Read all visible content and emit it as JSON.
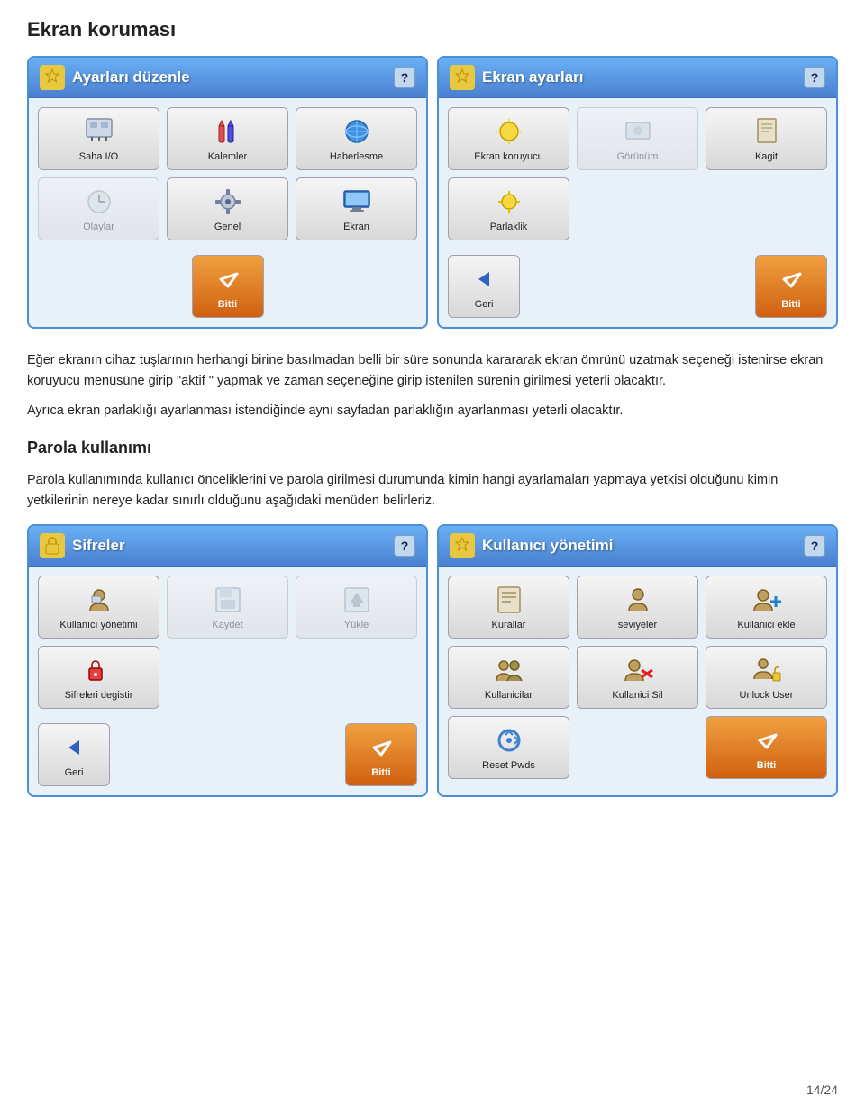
{
  "page": {
    "title": "Ekran koruması",
    "page_num": "14/24"
  },
  "panel1": {
    "header": "Ayarları düzenle",
    "help": "?",
    "buttons": [
      {
        "label": "Saha I/O",
        "icon": "wrench",
        "disabled": false
      },
      {
        "label": "Kalemler",
        "icon": "pen",
        "disabled": false
      },
      {
        "label": "Haberlesme",
        "icon": "comm",
        "disabled": false
      },
      {
        "label": "Olaylar",
        "icon": "clock",
        "disabled": true
      },
      {
        "label": "Genel",
        "icon": "gear",
        "disabled": false
      },
      {
        "label": "Ekran",
        "icon": "screen",
        "disabled": false
      }
    ],
    "bitti": "Bitti"
  },
  "panel2": {
    "header": "Ekran ayarları",
    "help": "?",
    "buttons": [
      {
        "label": "Ekran koruyucu",
        "icon": "sun",
        "disabled": false
      },
      {
        "label": "Görünüm",
        "icon": "theme",
        "disabled": true
      },
      {
        "label": "Kagit",
        "icon": "page",
        "disabled": false
      },
      {
        "label": "Parlaklik",
        "icon": "brightness",
        "disabled": false
      }
    ],
    "geri": "Geri",
    "bitti": "Bitti"
  },
  "texts": [
    "Eğer ekranın cihaz tuşlarının herhangi birine basılmadan belli bir süre sonunda karararak ekran ömrünü uzatmak seçeneği istenirse ekran koruyucu menüsüne  girip \"aktif \" yapmak ve zaman seçeneğine girip istenilen sürenin girilmesi yeterli olacaktır.",
    "Ayrıca ekran parlaklığı ayarlanması istendiğinde aynı sayfadan parlaklığın ayarlanması yeterli olacaktır."
  ],
  "section2_heading": "Parola kullanımı",
  "section2_text": "Parola kullanımında kullanıcı önceliklerini ve parola girilmesi durumunda kimin hangi ayarlamaları yapmaya yetkisi olduğunu kimin yetkilerinin nereye kadar sınırlı olduğunu aşağıdaki menüden belirleriz.",
  "panel3": {
    "header": "Sifreler",
    "help": "?",
    "buttons": [
      {
        "label": "Kullanıcı yönetimi",
        "icon": "users",
        "disabled": false
      },
      {
        "label": "Kaydet",
        "icon": "save",
        "disabled": true
      },
      {
        "label": "Yükle",
        "icon": "load",
        "disabled": true
      },
      {
        "label": "Sifreleri degistir",
        "icon": "key",
        "disabled": false
      }
    ],
    "geri": "Geri",
    "bitti": "Bitti"
  },
  "panel4": {
    "header": "Kullanıcı yönetimi",
    "help": "?",
    "buttons": [
      {
        "label": "Kurallar",
        "icon": "rules",
        "disabled": false
      },
      {
        "label": "seviyeler",
        "icon": "levels",
        "disabled": false
      },
      {
        "label": "Kullanici ekle",
        "icon": "useradd",
        "disabled": false
      },
      {
        "label": "Kullanicilar",
        "icon": "userlist",
        "disabled": false
      },
      {
        "label": "Kullanici Sil",
        "icon": "userdel",
        "disabled": false
      },
      {
        "label": "Unlock User",
        "icon": "unlock",
        "disabled": false
      },
      {
        "label": "Reset Pwds",
        "icon": "reset",
        "disabled": false
      }
    ],
    "bitti": "Bitti"
  }
}
